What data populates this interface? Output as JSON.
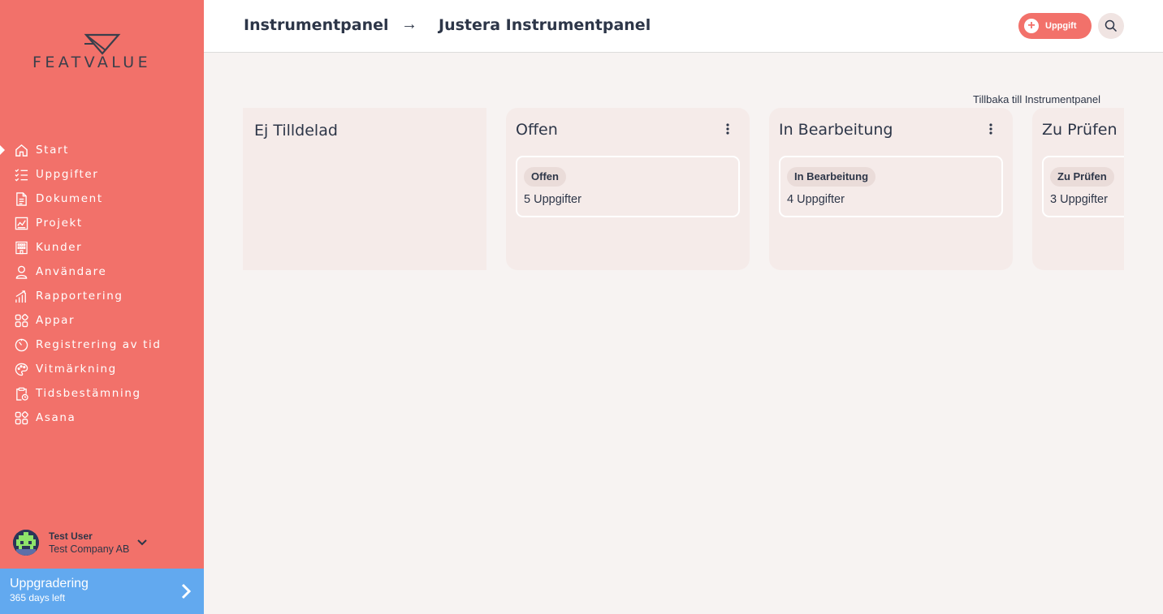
{
  "brand": {
    "logo_text": "FEATVALUE"
  },
  "sidebar": {
    "items": [
      {
        "label": "Start",
        "icon": "home-icon",
        "active": true
      },
      {
        "label": "Uppgifter",
        "icon": "task-list-icon"
      },
      {
        "label": "Dokument",
        "icon": "document-icon"
      },
      {
        "label": "Projekt",
        "icon": "project-chart-icon"
      },
      {
        "label": "Kunder",
        "icon": "building-icon"
      },
      {
        "label": "Användare",
        "icon": "user-icon"
      },
      {
        "label": "Rapportering",
        "icon": "bar-chart-icon"
      },
      {
        "label": "Appar",
        "icon": "apps-icon"
      },
      {
        "label": "Registrering av tid",
        "icon": "timer-icon"
      },
      {
        "label": "Vitmärkning",
        "icon": "palette-icon"
      },
      {
        "label": "Tidsbestämning",
        "icon": "clipboard-clock-icon"
      },
      {
        "label": "Asana",
        "icon": "apps-icon"
      }
    ],
    "user": {
      "name": "Test User",
      "company": "Test Company AB"
    },
    "upgrade": {
      "title": "Uppgradering",
      "subtitle": "365 days left"
    }
  },
  "header": {
    "breadcrumb": [
      "Instrumentpanel",
      "Justera Instrumentpanel"
    ],
    "breadcrumb_separator": "→",
    "task_button_label": "Uppgift"
  },
  "main": {
    "back_link": "Tillbaka till Instrumentpanel",
    "columns": [
      {
        "title": "Ej Tilldelad"
      },
      {
        "title": "Offen",
        "card": {
          "badge": "Offen",
          "count": "5 Uppgifter"
        }
      },
      {
        "title": "In Bearbeitung",
        "card": {
          "badge": "In Bearbeitung",
          "count": "4 Uppgifter"
        }
      },
      {
        "title": "Zu Prüfen",
        "card": {
          "badge": "Zu Prüfen",
          "count": "3 Uppgifter"
        }
      }
    ]
  },
  "colors": {
    "sidebar": "#f2716a",
    "upgrade": "#62a9ef",
    "text": "#2d3648",
    "column": "#f5ebe9",
    "background": "#f7f3f2"
  }
}
